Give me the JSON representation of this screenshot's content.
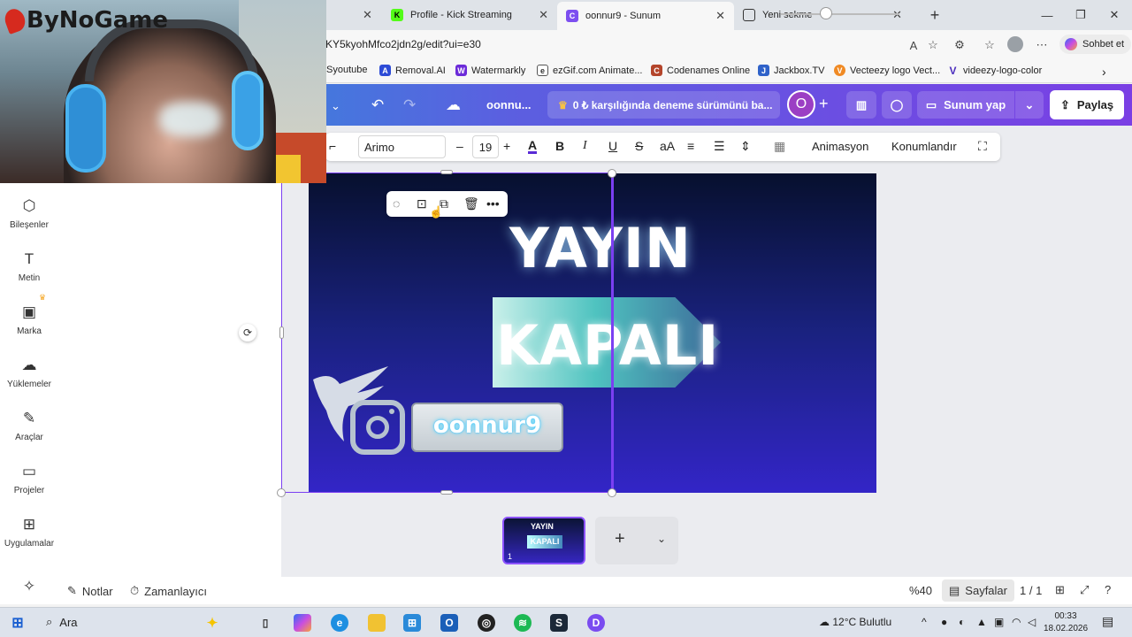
{
  "browser": {
    "tabs": [
      {
        "label": "Profile - Kick Streaming",
        "icon": "kick-icon",
        "color": "#53fc18"
      },
      {
        "label": "oonnur9 - Sunum",
        "icon": "canva-icon",
        "color": "#7d4ff0"
      },
      {
        "label": "Yeni sekme",
        "icon": "newtab-icon",
        "color": "#3a3a3a"
      }
    ],
    "url": "KY5kyohMfco2jdn2g/edit?ui=e30",
    "copilot_label": "Sohbet et",
    "bookmarks": [
      {
        "label": "Syoutube"
      },
      {
        "label": "Removal.AI"
      },
      {
        "label": "Watermarkly"
      },
      {
        "label": "ezGif.com Animate..."
      },
      {
        "label": "Codenames Online"
      },
      {
        "label": "Jackbox.TV"
      },
      {
        "label": "Vecteezy logo Vect..."
      },
      {
        "label": "videezy-logo-color"
      }
    ]
  },
  "canva_header": {
    "doc_name": "oonnu...",
    "trial_text": "0 ₺ karşılığında deneme sürümünü ba...",
    "user_initial": "O",
    "present_label": "Sunum yap",
    "share_label": "Paylaş"
  },
  "format_bar": {
    "font": "Arimo",
    "size": "19",
    "animation_label": "Animasyon",
    "position_label": "Konumlandır"
  },
  "sidebar": {
    "items": [
      {
        "label": "Bileşenler",
        "icon": "elements-icon"
      },
      {
        "label": "Metin",
        "icon": "text-icon"
      },
      {
        "label": "Marka",
        "icon": "brand-icon"
      },
      {
        "label": "Yüklemeler",
        "icon": "upload-icon"
      },
      {
        "label": "Araçlar",
        "icon": "tools-icon"
      },
      {
        "label": "Projeler",
        "icon": "folder-icon"
      },
      {
        "label": "Uygulamalar",
        "icon": "apps-icon"
      }
    ]
  },
  "slide": {
    "title": "YAYIN",
    "subtitle": "KAPALI",
    "username": "oonnur9"
  },
  "pages": {
    "thumb_title": "YAYIN",
    "thumb_subtitle": "KAPALI",
    "thumb_number": "1"
  },
  "status_bar": {
    "notes_label": "Notlar",
    "timer_label": "Zamanlayıcı",
    "zoom": "%40",
    "zoom_fraction": 0.38,
    "pages_label": "Sayfalar",
    "page_count": "1 / 1"
  },
  "taskbar": {
    "search_label": "Ara",
    "weather": "12°C  Bulutlu",
    "time": "00:33",
    "date": "18.02.2026"
  },
  "overlay": {
    "logo_text": "ByNoGame"
  }
}
